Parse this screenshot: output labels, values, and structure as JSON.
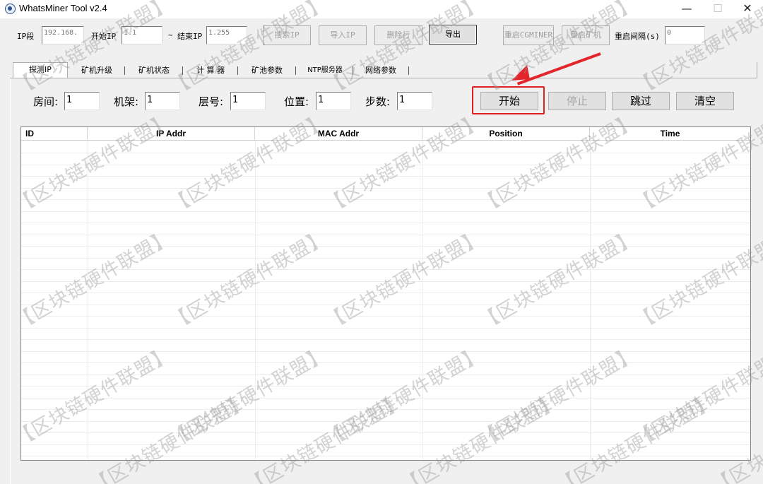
{
  "window": {
    "title": "WhatsMiner Tool v2.4",
    "minimize_glyph": "—",
    "maximize_glyph": "☐",
    "close_glyph": "✕"
  },
  "toolbar": {
    "ip_segment_label": "IP段",
    "ip_segment_value": "192.168.",
    "start_ip_label": "开始IP",
    "start_ip_value": "1.1",
    "tilde": "~",
    "end_ip_label": "结束IP",
    "end_ip_value": "1.255",
    "scan_ip_button": "搜索IP",
    "import_ip_button": "导入IP",
    "delete_row_button": "删除行",
    "export_button": "导出",
    "restart_cgminer_button": "重启CGMINER",
    "restart_miner_button": "重启矿机",
    "restart_interval_label": "重启间隔(s)",
    "restart_interval_value": "0"
  },
  "tabs": [
    {
      "label": "探测IP",
      "active": true
    },
    {
      "label": "矿机升级",
      "active": false
    },
    {
      "label": "矿机状态",
      "active": false
    },
    {
      "label": "计 算 器",
      "active": false
    },
    {
      "label": "矿池参数",
      "active": false
    },
    {
      "label": "NTP服务器",
      "active": false
    },
    {
      "label": "网络参数",
      "active": false
    }
  ],
  "probe": {
    "room_label": "房间:",
    "room_value": "1",
    "rack_label": "机架:",
    "rack_value": "1",
    "layer_label": "层号:",
    "layer_value": "1",
    "position_label": "位置:",
    "position_value": "1",
    "step_label": "步数:",
    "step_value": "1",
    "start_button": "开始",
    "stop_button": "停止",
    "skip_button": "跳过",
    "clear_button": "清空"
  },
  "table": {
    "columns": [
      "ID",
      "IP Addr",
      "MAC Addr",
      "Position",
      "Time"
    ],
    "rows": []
  },
  "annotation": {
    "highlight_color": "#e02020"
  },
  "watermark": {
    "text": "【区块链硬件联盟】"
  }
}
